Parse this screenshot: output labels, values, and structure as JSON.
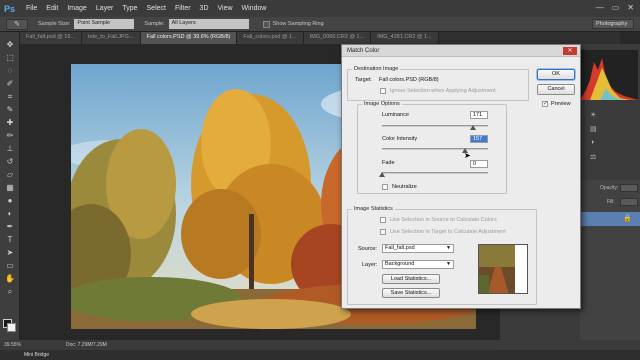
{
  "app": {
    "logo": "Ps",
    "menu": [
      "File",
      "Edit",
      "Image",
      "Layer",
      "Type",
      "Select",
      "Filter",
      "3D",
      "View",
      "Window"
    ],
    "window_controls": [
      "—",
      "▭",
      "✕"
    ]
  },
  "options_bar": {
    "sample_size_label": "Sample Size:",
    "sample_size_value": "Point Sample",
    "sample_label": "Sample:",
    "sample_value": "All Layers",
    "show_ring_label": "Show Sampling Ring",
    "workspace": "Photography"
  },
  "tabs": [
    {
      "label": "Fall_falt.psd @ 16...",
      "active": false
    },
    {
      "label": "tute_to_Fall.JPG...",
      "active": false
    },
    {
      "label": "Fall colors.PSD @ 39.6% (RGB/8)",
      "active": true
    },
    {
      "label": "Fall_colors.psd @ 1...",
      "active": false
    },
    {
      "label": "IMG_0066.CR2 @ 1...",
      "active": false
    },
    {
      "label": "IMG_4281.CR2 @ 1...",
      "active": false
    }
  ],
  "status": {
    "zoom": "39.55%",
    "doc": "Doc: 7.29M/7.29M",
    "mini_bridge": "Mini Bridge"
  },
  "panels": {
    "opacity_label": "Opacity:",
    "fill_label": "Fill:"
  },
  "dialog": {
    "title": "Match Color",
    "destination": {
      "group_title": "Destination Image",
      "target_label": "Target:",
      "target_value": "Fall colors.PSD (RGB/8)",
      "ignore_selection": "Ignore Selection when Applying Adjustment"
    },
    "image_options": {
      "group_title": "Image Options",
      "luminance_label": "Luminance",
      "luminance_value": "171",
      "luminance_fraction": 0.855,
      "color_intensity_label": "Color Intensity",
      "color_intensity_value": "157",
      "color_intensity_fraction": 0.785,
      "fade_label": "Fade",
      "fade_value": "0",
      "fade_fraction": 0.0,
      "neutralize_label": "Neutralize"
    },
    "image_statistics": {
      "group_title": "Image Statistics",
      "use_sel_source": "Use Selection in Source to Calculate Colors",
      "use_sel_target": "Use Selection in Target to Calculate Adjustment",
      "source_label": "Source:",
      "source_value": "Fall_falt.psd",
      "layer_label": "Layer:",
      "layer_value": "Background",
      "load_button": "Load Statistics...",
      "save_button": "Save Statistics..."
    },
    "ok_button": "OK",
    "cancel_button": "Cancel",
    "preview_label": "Preview",
    "preview_checked": true
  }
}
